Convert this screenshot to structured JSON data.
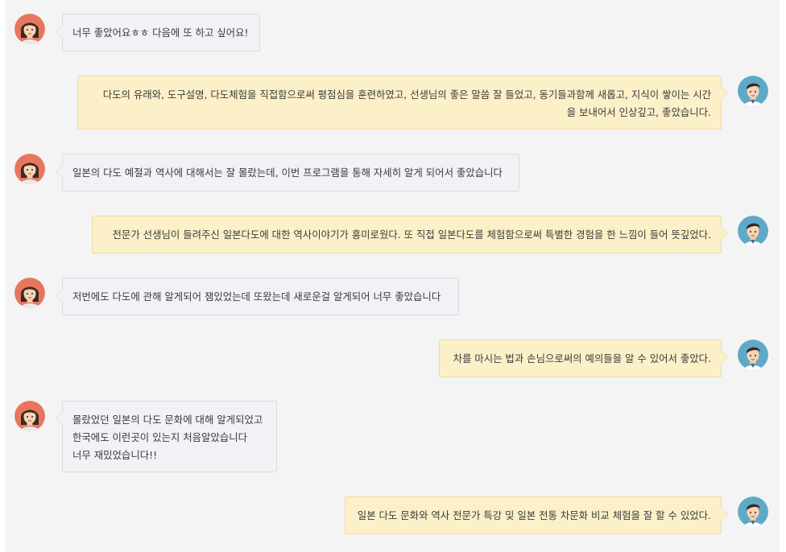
{
  "messages": [
    {
      "side": "left",
      "lines": [
        "너무 좋았어요ㅎㅎ 다음에 또 하고 싶어요!"
      ]
    },
    {
      "side": "right",
      "lines": [
        "다도의 유래와, 도구설명, 다도체험을 직접함으로써 평점심을 훈련하였고, 선생님의 좋은 말씀 잘 들었고, 동기들과함께 새롭고, 지식이 쌓이는 시간",
        "을 보내어서 인상깊고, 좋았습니다."
      ]
    },
    {
      "side": "left",
      "lines": [
        "일본의 다도 예절과 역사에 대해서는 잘 몰랐는데, 이번 프로그램을 통해 자세히 알게 되어서 좋았습니다"
      ]
    },
    {
      "side": "right",
      "lines": [
        "전문가 선생님이 들려주신 일본다도에 대한 역사이야기가 흥미로웠다. 또 직접 일본다도를 체험함으로써 특별한 경험을 한 느낌이 들어 뜻깊었다."
      ]
    },
    {
      "side": "left",
      "lines": [
        "저번에도 다도에 관해 알게되어 잼있었는데 또왔는데 새로운걸 알게되어 너무 좋았습니다"
      ]
    },
    {
      "side": "right",
      "lines": [
        "차를 마시는 법과 손님으로써의 예의들을 알 수 있어서 좋았다."
      ]
    },
    {
      "side": "left",
      "lines": [
        "몰랐었던 일본의 다도 문화에 대해 알게되었고",
        "한국에도 이런곳이 있는지 처음알았습니다",
        "너무 재밌었습니다!!"
      ]
    },
    {
      "side": "right",
      "lines": [
        "일본 다도 문화와 역사 전문가 특강 및 일본 전통 차문화 비교 체험을 잘 할 수 있었다."
      ]
    }
  ],
  "colors": {
    "panel_bg": "#f4f4f4",
    "left_bubble_bg": "#f1f2f6",
    "left_bubble_border": "#d9dbe2",
    "right_bubble_bg": "#fcf0c8",
    "right_bubble_border": "#ecdcaa",
    "female_avatar_bg": "#e8765f",
    "male_avatar_bg": "#5fa9c8"
  },
  "avatars": {
    "left": "female-avatar-icon",
    "right": "male-avatar-icon"
  }
}
